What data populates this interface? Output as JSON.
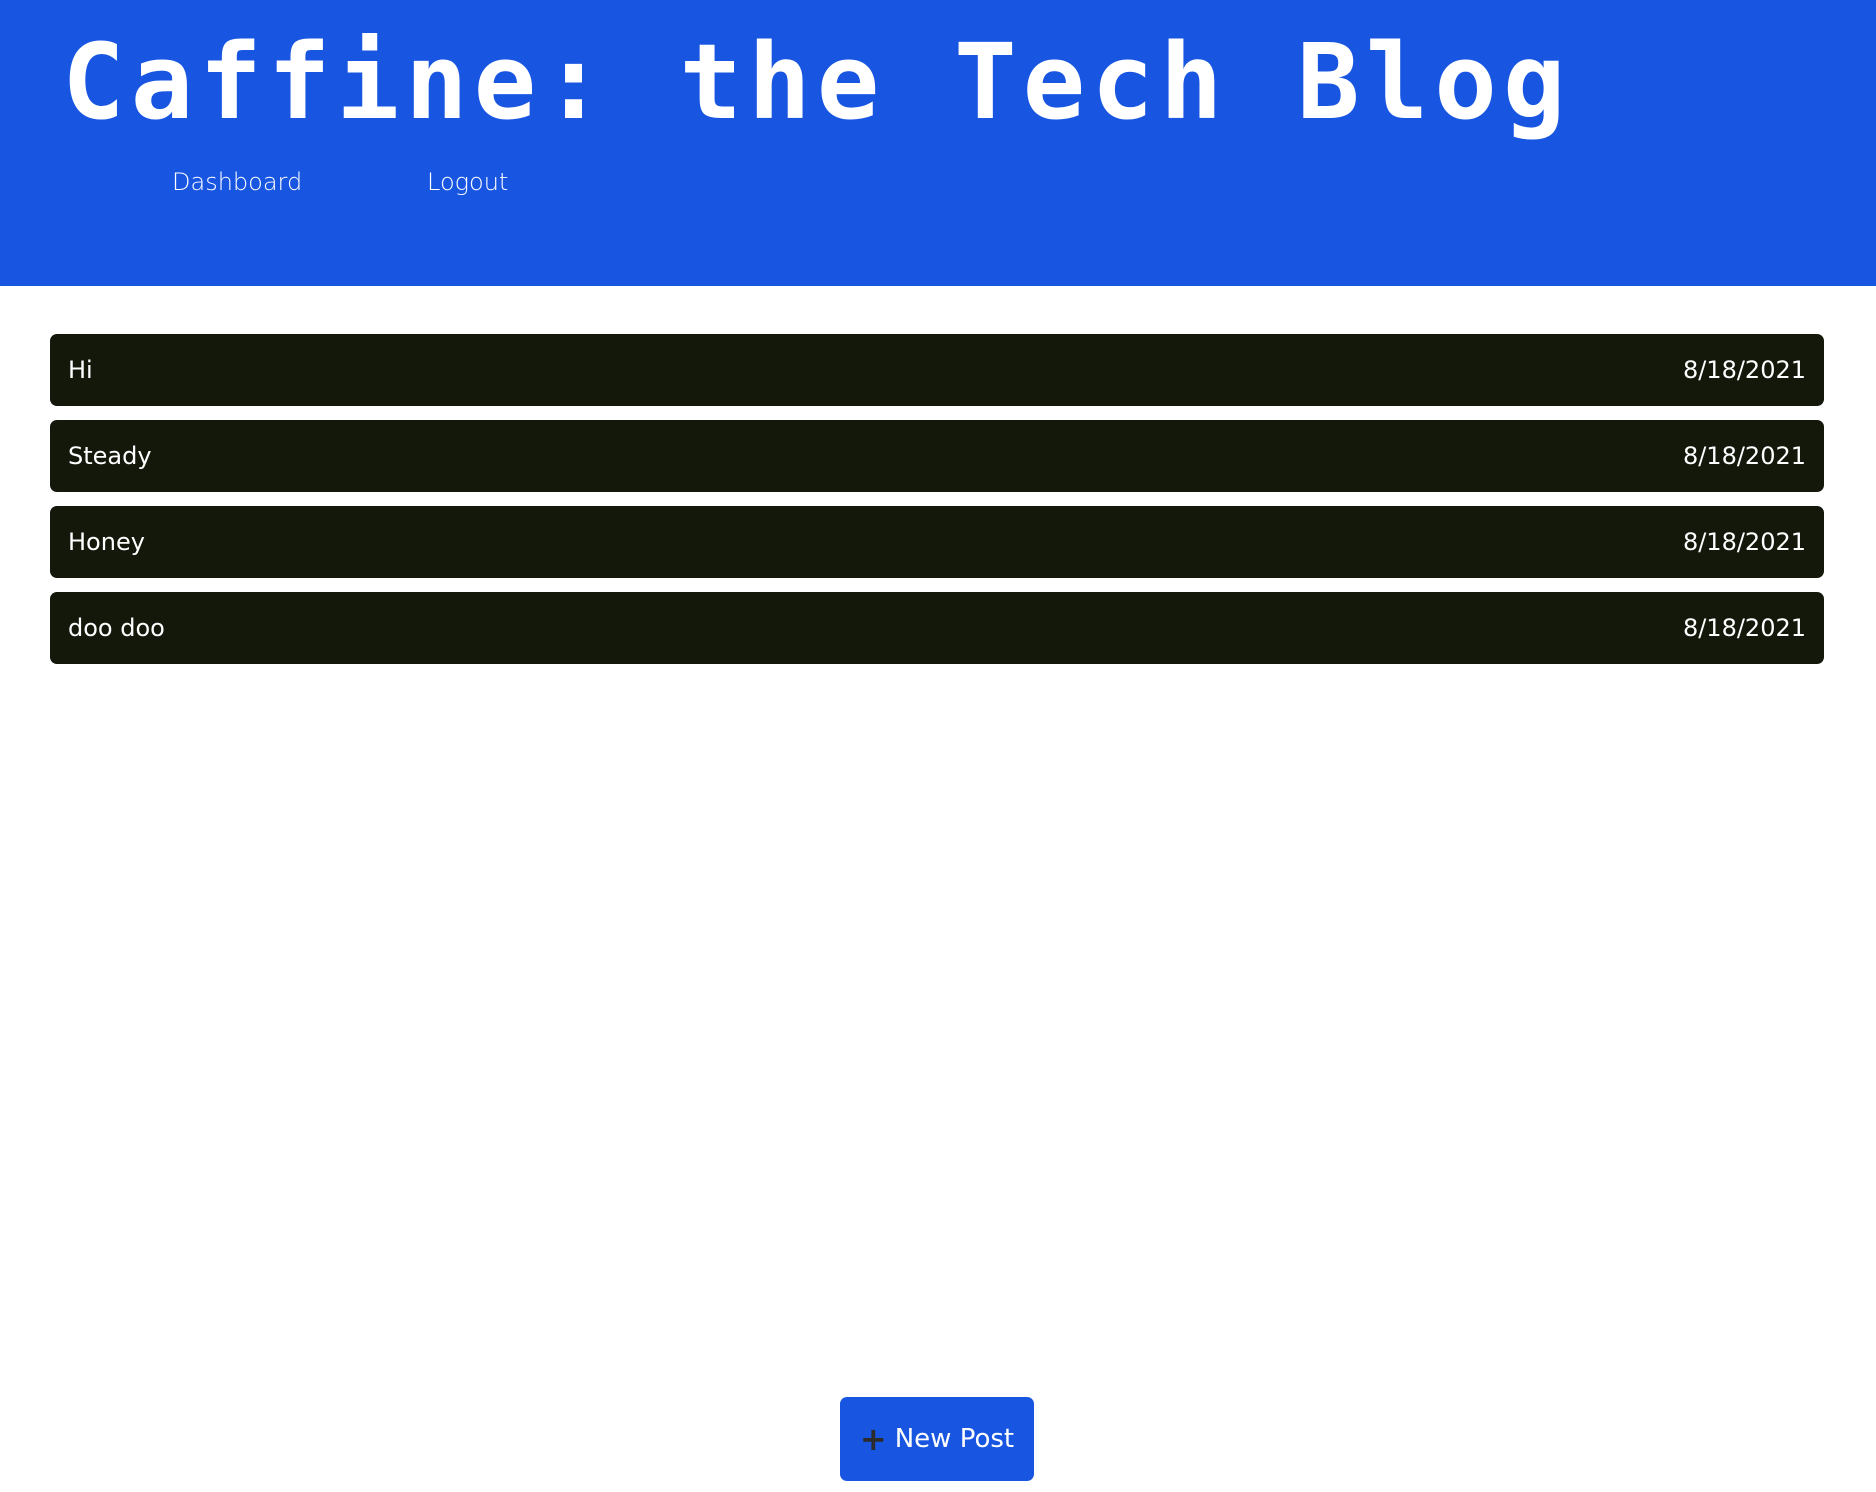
{
  "header": {
    "title": "Caffine: the Tech Blog",
    "nav": {
      "dashboard": "Dashboard",
      "logout": "Logout"
    }
  },
  "posts": [
    {
      "title": "Hi",
      "date": "8/18/2021"
    },
    {
      "title": "Steady",
      "date": "8/18/2021"
    },
    {
      "title": "Honey",
      "date": "8/18/2021"
    },
    {
      "title": "doo doo",
      "date": "8/18/2021"
    }
  ],
  "new_post": {
    "icon": "plus-icon",
    "label": "New Post"
  },
  "colors": {
    "header_bg": "#1856e2",
    "post_bg": "#13180b",
    "text": "#ffffff"
  }
}
